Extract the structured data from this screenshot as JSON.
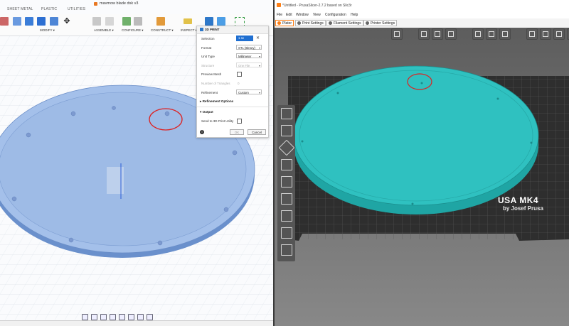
{
  "fusion": {
    "tabs": [
      "SHEET METAL",
      "PLASTIC",
      "UTILITIES"
    ],
    "document_title": "mavmow blade dsk v3",
    "ribbon_groups": [
      "MODIFY ▾",
      "ASSEMBLE ▾",
      "CONFIGURE ▾",
      "CONSTRUCT ▾",
      "INSPECT ▾"
    ],
    "print3d_label": "3D PRINT",
    "dialog": {
      "selection_label": "Selection",
      "selection_value": "1 se",
      "format_label": "Format",
      "format_value": "STL (Binary)",
      "unit_type_label": "Unit Type",
      "unit_type_value": "Millimeter",
      "structure_label": "Structure",
      "structure_value": "One File",
      "preview_mesh_label": "Preview Mesh",
      "triangles_label": "Number of Triangles",
      "triangles_value": "0",
      "refinement_label": "Refinement",
      "refinement_value": "Custom",
      "refinement_options_label": "Refinement Options",
      "output_label": "Output",
      "send_to_utility_label": "Send to 3D Print Utility",
      "ok_label": "OK",
      "cancel_label": "Cancel"
    }
  },
  "prusa": {
    "window_title": "*Untitled - PrusaSlicer-2.7.2 based on Slic3r",
    "menus": [
      "File",
      "Edit",
      "Window",
      "View",
      "Configuration",
      "Help"
    ],
    "tabs": [
      "Plater",
      "Print Settings",
      "Filament Settings",
      "Printer Settings"
    ],
    "bed_brand": "USA MK4",
    "bed_maker": "by Josef Prusa",
    "colors": {
      "model": "#2fc1c0",
      "bed_dark": "#2e2e2e",
      "accent": "#fd7e14"
    }
  },
  "annotation": {
    "color": "#dd2222"
  }
}
